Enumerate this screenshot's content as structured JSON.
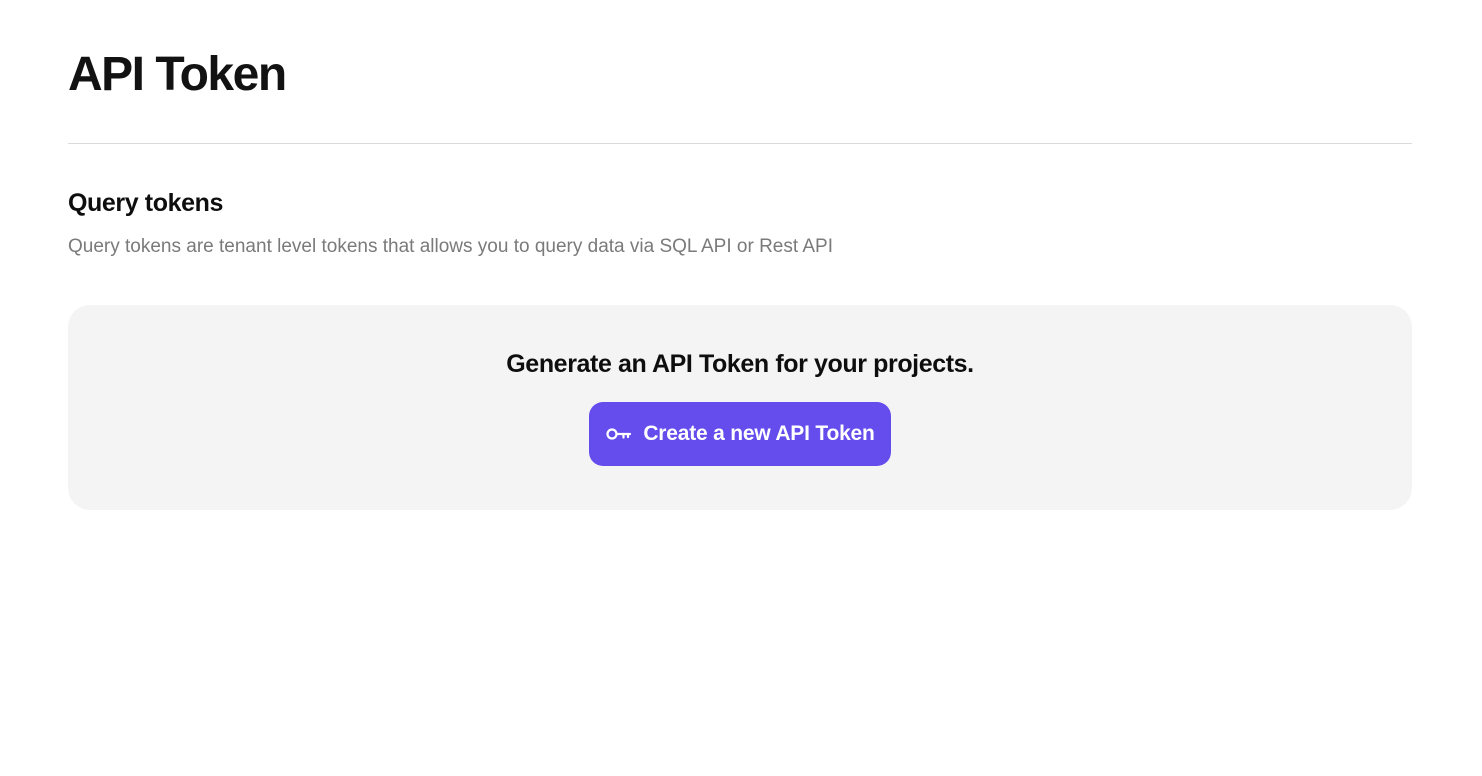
{
  "page": {
    "title": "API Token"
  },
  "query_tokens": {
    "heading": "Query tokens",
    "description": "Query tokens are tenant level tokens that allows you to query data via SQL API or Rest API"
  },
  "empty_state": {
    "message": "Generate an API Token for your projects.",
    "create_button": {
      "label": "Create a new API Token",
      "icon": "key-icon"
    }
  },
  "colors": {
    "accent": "#644ced",
    "card_background": "#f4f4f4",
    "divider": "#dadada",
    "muted_text": "#7a7a7a"
  }
}
